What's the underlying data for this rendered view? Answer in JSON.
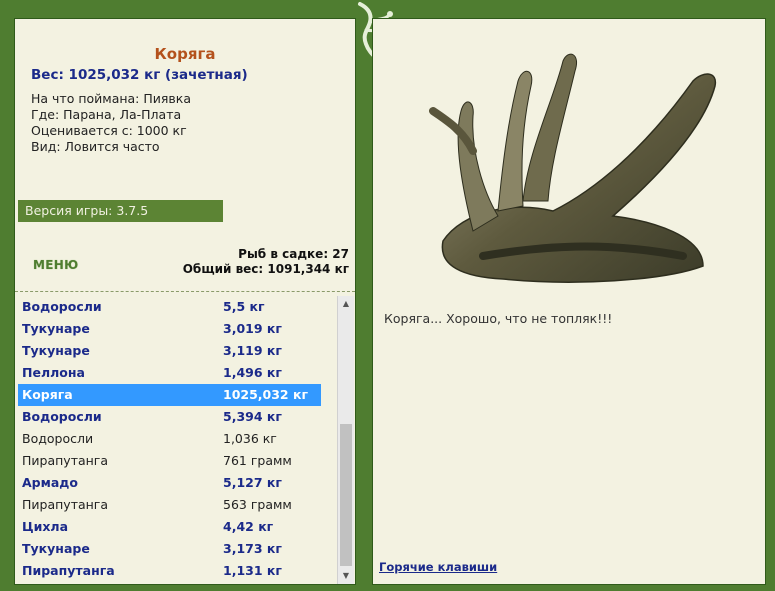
{
  "fish": {
    "title": "Коряга",
    "weight_line": "Вес: 1025,032 кг (зачетная)",
    "caught_on": "На что поймана: Пиявка",
    "location": "Где: Парана, Ла-Плата",
    "valued_from": "Оценивается с: 1000 кг",
    "kind": "Вид: Ловится часто"
  },
  "version": "Версия игры: 3.7.5",
  "menu_label": "МЕНЮ",
  "stats": {
    "fish_count": "Рыб в садке: 27",
    "total_weight": "Общий вес: 1091,344 кг"
  },
  "catch_list": [
    {
      "name": "Водоросли",
      "weight": "5,5 кг",
      "style": "bold"
    },
    {
      "name": "Тукунаре",
      "weight": "3,019 кг",
      "style": "bold"
    },
    {
      "name": "Тукунаре",
      "weight": "3,119 кг",
      "style": "bold"
    },
    {
      "name": "Пеллона",
      "weight": "1,496 кг",
      "style": "bold"
    },
    {
      "name": "Коряга",
      "weight": "1025,032 кг",
      "style": "sel"
    },
    {
      "name": "Водоросли",
      "weight": "5,394 кг",
      "style": "bold"
    },
    {
      "name": "Водоросли",
      "weight": "1,036 кг",
      "style": "plain"
    },
    {
      "name": "Пирапутанга",
      "weight": "761 грамм",
      "style": "plain"
    },
    {
      "name": "Армадо",
      "weight": "5,127 кг",
      "style": "bold"
    },
    {
      "name": "Пирапутанга",
      "weight": "563 грамм",
      "style": "plain"
    },
    {
      "name": "Цихла",
      "weight": "4,42 кг",
      "style": "bold"
    },
    {
      "name": "Тукунаре",
      "weight": "3,173 кг",
      "style": "bold"
    },
    {
      "name": "Пирапутанга",
      "weight": "1,131 кг",
      "style": "bold"
    }
  ],
  "caption": "Коряга... Хорошо, что не топляк!!!",
  "hotkeys_link": "Горячие клавиши",
  "icons": {
    "logo": "lizard-logo-icon",
    "scroll_up": "arrow-up-icon",
    "scroll_down": "arrow-down-icon"
  },
  "colors": {
    "frame": "#4f7d30",
    "panel": "#f3f2e1",
    "title": "#b4521c",
    "bold_text": "#1b2a8a",
    "selection": "#3399ff"
  }
}
